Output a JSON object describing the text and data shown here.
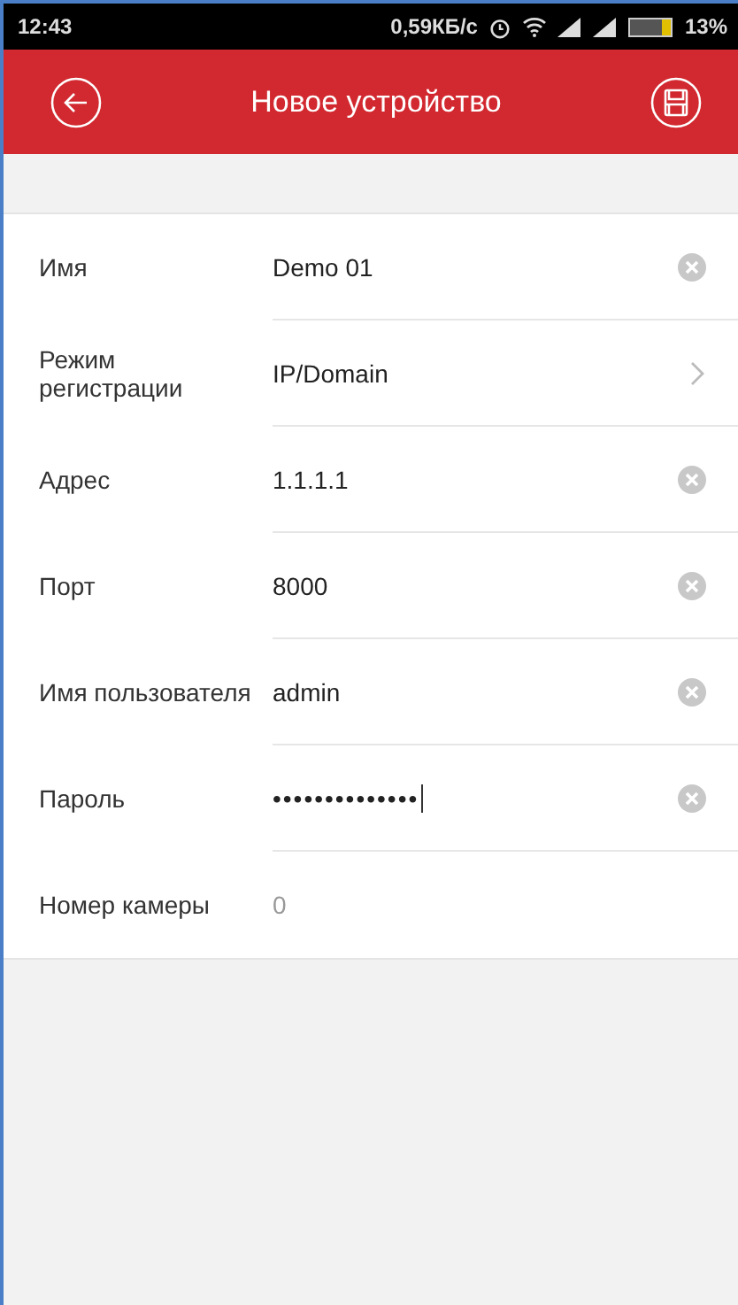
{
  "status_bar": {
    "time": "12:43",
    "speed": "0,59КБ/с",
    "battery": "13%"
  },
  "header": {
    "title": "Новое устройство"
  },
  "fields": [
    {
      "label": "Имя",
      "value": "Demo 01",
      "kind": "clear"
    },
    {
      "label": "Режим регистрации",
      "value": "IP/Domain",
      "kind": "select"
    },
    {
      "label": "Адрес",
      "value": "1.1.1.1",
      "kind": "clear"
    },
    {
      "label": "Порт",
      "value": "8000",
      "kind": "clear"
    },
    {
      "label": "Имя пользователя",
      "value": "admin",
      "kind": "clear"
    },
    {
      "label": "Пароль",
      "value": "••••••••••••••",
      "kind": "password"
    },
    {
      "label": "Номер камеры",
      "value": "0",
      "kind": "readonly"
    }
  ]
}
